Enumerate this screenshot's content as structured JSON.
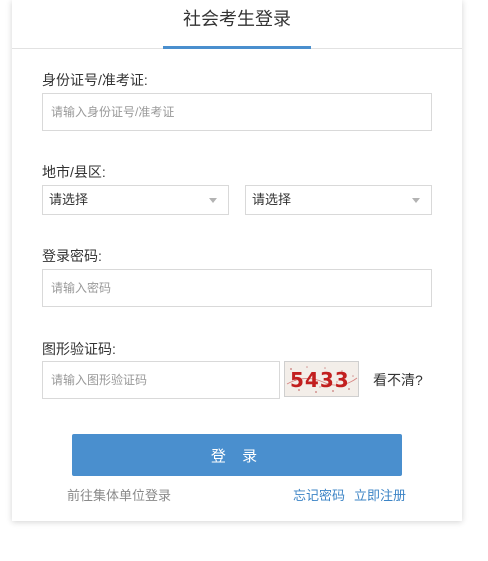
{
  "tab": {
    "title": "社会考生登录"
  },
  "id_field": {
    "label": "身份证号/准考证:",
    "placeholder": "请输入身份证号/准考证"
  },
  "region": {
    "label": "地市/县区:",
    "city": "请选择",
    "county": "请选择"
  },
  "password": {
    "label": "登录密码:",
    "placeholder": "请输入密码"
  },
  "captcha": {
    "label": "图形验证码:",
    "placeholder": "请输入图形验证码",
    "code": "5433",
    "refresh_label": "看不清?"
  },
  "login_button": {
    "label": "登 录"
  },
  "links": {
    "group_login": "前往集体单位登录",
    "forgot": "忘记密码",
    "register": "立即注册"
  },
  "colors": {
    "accent": "#4a8fce",
    "captcha_text": "#c21f1f"
  }
}
